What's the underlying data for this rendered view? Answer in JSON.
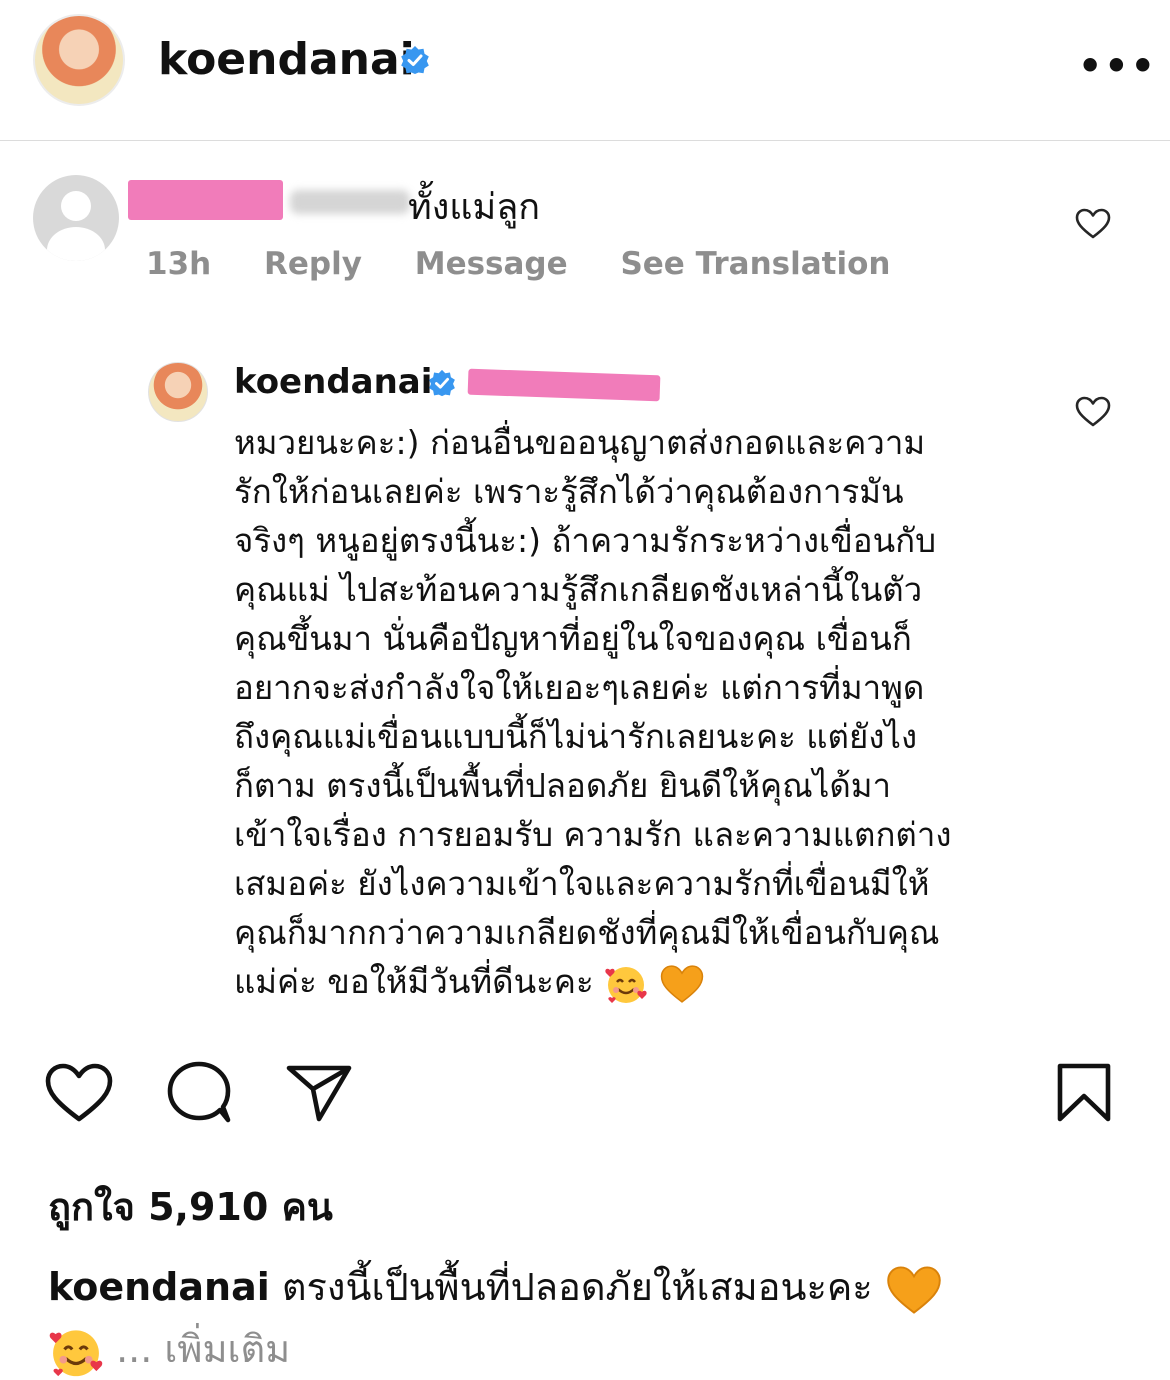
{
  "header": {
    "username": "koendanai",
    "more_icon": "more-horizontal-icon",
    "more_label": "•••"
  },
  "comment": {
    "text_visible": "ทั้งแม่ลูก",
    "time": "13h",
    "reply_label": "Reply",
    "message_label": "Message",
    "translate_label": "See Translation"
  },
  "reply": {
    "username": "koendanai",
    "lines": [
      "หมวยนะคะ:) ก่อนอื่นขออนุญาตส่งกอดและความ",
      "รักให้ก่อนเลยค่ะ เพราะรู้สึกได้ว่าคุณต้องการมัน",
      "จริงๆ หนูอยู่ตรงนี้นะ:) ถ้าความรักระหว่างเขื่อนกับ",
      "คุณแม่ ไปสะท้อนความรู้สึกเกลียดชังเหล่านี้ในตัว",
      "คุณขึ้นมา นั่นคือปัญหาที่อยู่ในใจของคุณ เขื่อนก็",
      "อยากจะส่งกำลังใจให้เยอะๆเลยค่ะ แต่การที่มาพูด",
      "ถึงคุณแม่เขื่อนแบบนี้ก็ไม่น่ารักเลยนะคะ แต่ยังไง",
      "ก็ตาม ตรงนี้เป็นพื้นที่ปลอดภัย ยินดีให้คุณได้มา",
      "เข้าใจเรื่อง การยอมรับ ความรัก และความแตกต่าง",
      "เสมอค่ะ ยังไงความเข้าใจและความรักที่เขื่อนมีให้",
      "คุณก็มากกว่าความเกลียดชังที่คุณมีให้เขื่อนกับคุณ",
      "แม่ค่ะ ขอให้มีวันที่ดีนะคะ"
    ],
    "emojis": [
      "smiling-face-with-hearts",
      "orange-heart"
    ]
  },
  "likes_text": "ถูกใจ 5,910 คน",
  "caption": {
    "username": "koendanai",
    "text": "ตรงนี้เป็นพื้นที่ปลอดภัยให้เสมอนะคะ",
    "more": "... เพิ่มเติม"
  },
  "colors": {
    "verified": "#3897f0",
    "redaction": "#f17cba",
    "meta": "#8e8e8e",
    "orange_heart": "#f6a01a"
  }
}
